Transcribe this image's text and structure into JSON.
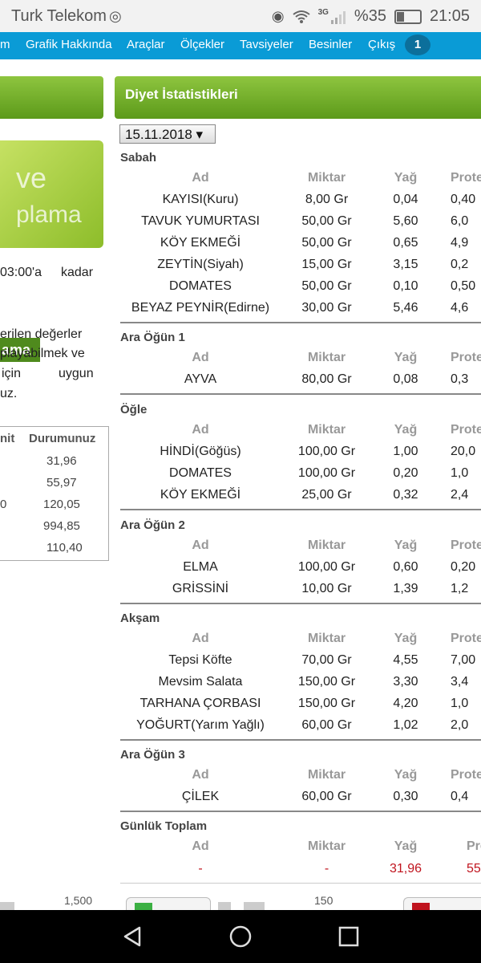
{
  "status_bar": {
    "carrier": "Turk Telekom",
    "battery": "%35",
    "time": "21:05",
    "network": "3G",
    "battery_level": 0.35
  },
  "nav": {
    "items": [
      "m",
      "Grafik Hakkında",
      "Araçlar",
      "Ölçekler",
      "Tavsiyeler",
      "Besinler",
      "Çıkış"
    ],
    "badge": "1"
  },
  "left": {
    "banner_top": "ve",
    "banner_pill": "ama",
    "banner_bottom": "plama",
    "text1_a": "03:00'a",
    "text1_b": "kadar",
    "text2": "erilen değerler",
    "text3": "playabilmek ve",
    "text4_a": "için",
    "text4_b": "uygun",
    "text5": "uz.",
    "table_header_a": "nit",
    "table_header_b": "Durumunuz",
    "extra_val": "0",
    "table_values": [
      "31,96",
      "55,97",
      "120,05",
      "994,85",
      "110,40"
    ]
  },
  "card": {
    "title": "Diyet İstatistikleri",
    "date": "15.11.2018 ▾"
  },
  "headers": {
    "ad": "Ad",
    "miktar": "Miktar",
    "yag": "Yağ",
    "protein": "Prote",
    "protein_total": "Pro"
  },
  "meals": [
    {
      "title": "Sabah",
      "rows": [
        {
          "ad": "KAYISI(Kuru)",
          "miktar": "8,00 Gr",
          "yag": "0,04",
          "protein": "0,40"
        },
        {
          "ad": "TAVUK YUMURTASI",
          "miktar": "50,00 Gr",
          "yag": "5,60",
          "protein": "6,0"
        },
        {
          "ad": "KÖY EKMEĞİ",
          "miktar": "50,00 Gr",
          "yag": "0,65",
          "protein": "4,9"
        },
        {
          "ad": "ZEYTİN(Siyah)",
          "miktar": "15,00 Gr",
          "yag": "3,15",
          "protein": "0,2"
        },
        {
          "ad": "DOMATES",
          "miktar": "50,00 Gr",
          "yag": "0,10",
          "protein": "0,50"
        },
        {
          "ad": "BEYAZ PEYNİR(Edirne)",
          "miktar": "30,00 Gr",
          "yag": "5,46",
          "protein": "4,6"
        }
      ]
    },
    {
      "title": "Ara Öğün 1",
      "rows": [
        {
          "ad": "AYVA",
          "miktar": "80,00 Gr",
          "yag": "0,08",
          "protein": "0,3"
        }
      ]
    },
    {
      "title": "Öğle",
      "rows": [
        {
          "ad": "HİNDİ(Göğüs)",
          "miktar": "100,00 Gr",
          "yag": "1,00",
          "protein": "20,0"
        },
        {
          "ad": "DOMATES",
          "miktar": "100,00 Gr",
          "yag": "0,20",
          "protein": "1,0"
        },
        {
          "ad": "KÖY EKMEĞİ",
          "miktar": "25,00 Gr",
          "yag": "0,32",
          "protein": "2,4"
        }
      ]
    },
    {
      "title": "Ara Öğün 2",
      "rows": [
        {
          "ad": "ELMA",
          "miktar": "100,00 Gr",
          "yag": "0,60",
          "protein": "0,20"
        },
        {
          "ad": "GRİSSİNİ",
          "miktar": "10,00 Gr",
          "yag": "1,39",
          "protein": "1,2"
        }
      ]
    },
    {
      "title": "Akşam",
      "rows": [
        {
          "ad": "Tepsi Köfte",
          "miktar": "70,00 Gr",
          "yag": "4,55",
          "protein": "7,00"
        },
        {
          "ad": "Mevsim Salata",
          "miktar": "150,00 Gr",
          "yag": "3,30",
          "protein": "3,4"
        },
        {
          "ad": "TARHANA ÇORBASI",
          "miktar": "150,00 Gr",
          "yag": "4,20",
          "protein": "1,0"
        },
        {
          "ad": "YOĞURT(Yarım Yağlı)",
          "miktar": "60,00 Gr",
          "yag": "1,02",
          "protein": "2,0"
        }
      ]
    },
    {
      "title": "Ara Öğün 3",
      "rows": [
        {
          "ad": "ÇİLEK",
          "miktar": "60,00 Gr",
          "yag": "0,30",
          "protein": "0,4"
        }
      ]
    }
  ],
  "total": {
    "title": "Günlük Toplam",
    "ad": "-",
    "miktar": "-",
    "yag": "31,96",
    "protein": "55"
  },
  "bottom": {
    "left_value": "1,500",
    "right_value": "150"
  },
  "colors": {
    "nav": "#0a9bd6",
    "green": "#7ab32e",
    "red": "#c0141e"
  }
}
